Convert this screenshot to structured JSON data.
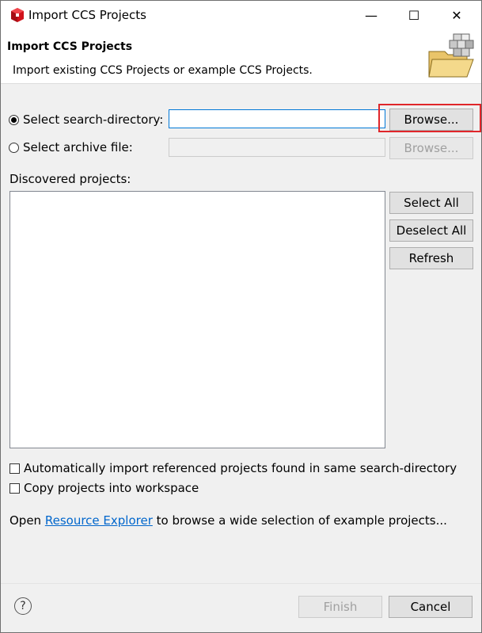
{
  "window": {
    "title": "Import CCS Projects",
    "controls": {
      "minimize": "—",
      "maximize": "☐",
      "close": "✕"
    }
  },
  "banner": {
    "title": "Import CCS Projects",
    "description": "Import existing CCS Projects or example CCS Projects."
  },
  "source": {
    "search_directory_label": "Select search-directory:",
    "search_directory_value": "",
    "search_directory_checked": true,
    "archive_label": "Select archive file:",
    "archive_value": "",
    "archive_checked": false,
    "browse_label": "Browse...",
    "browse_archive_label": "Browse..."
  },
  "discovered": {
    "label": "Discovered projects:",
    "items": [],
    "select_all_label": "Select All",
    "deselect_all_label": "Deselect All",
    "refresh_label": "Refresh"
  },
  "options": {
    "auto_import_label": "Automatically import referenced projects found in same search-directory",
    "auto_import_checked": false,
    "copy_label": "Copy projects into workspace",
    "copy_checked": false
  },
  "resource": {
    "prefix": "Open ",
    "link_text": "Resource Explorer",
    "suffix": " to browse a wide selection of example projects..."
  },
  "footer": {
    "help_icon": "?",
    "finish_label": "Finish",
    "cancel_label": "Cancel"
  },
  "colors": {
    "highlight": "#e0262a",
    "link": "#0066cc",
    "accent": "#0078d7"
  }
}
